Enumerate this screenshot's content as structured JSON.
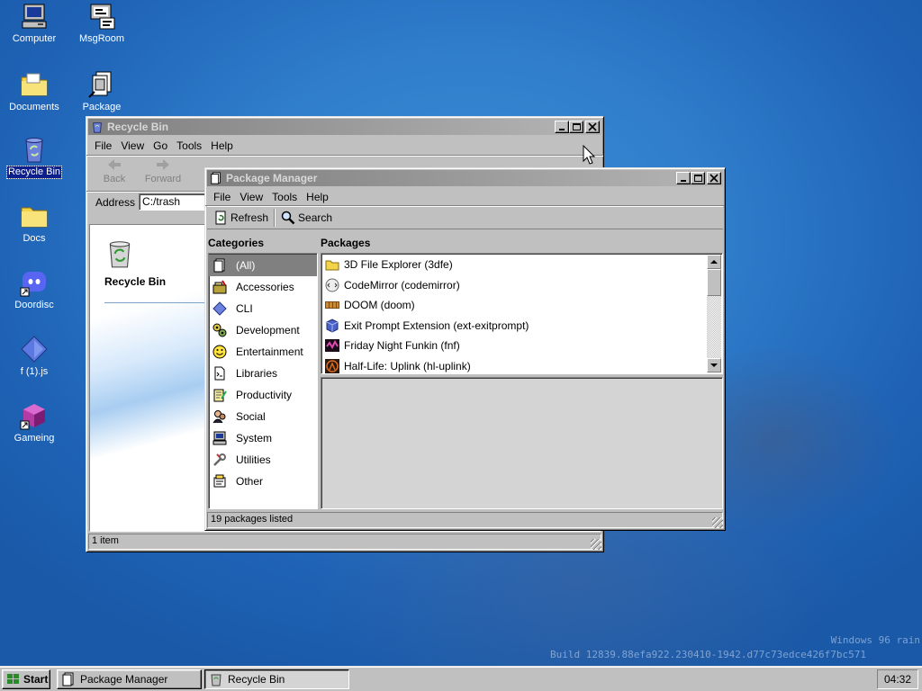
{
  "desktop": {
    "icons": [
      {
        "label": "Computer",
        "icon": "computer-icon"
      },
      {
        "label": "MsgRoom",
        "icon": "msgroom-icon"
      },
      {
        "label": "Documents",
        "icon": "folder-icon"
      },
      {
        "label": "Package",
        "icon": "package-icon"
      },
      {
        "label": "Recycle Bin",
        "icon": "recycle-bin-icon"
      },
      {
        "label": "Docs",
        "icon": "folder-icon"
      },
      {
        "label": "Doordisc",
        "icon": "discord-icon"
      },
      {
        "label": "f (1).js",
        "icon": "js-file-icon"
      },
      {
        "label": "Gameing",
        "icon": "cube-icon"
      }
    ],
    "watermark_line1": "Windows 96 rain",
    "watermark_line2": "Build 12839.88efa922.230410-1942.d77c73edce426f7bc571"
  },
  "recycle_bin": {
    "title": "Recycle Bin",
    "menu": [
      "File",
      "View",
      "Go",
      "Tools",
      "Help"
    ],
    "toolbar": {
      "back": "Back",
      "forward": "Forward"
    },
    "address_label": "Address",
    "address_value": "C:/trash",
    "heading": "Recycle Bin",
    "status": "1 item"
  },
  "package_manager": {
    "title": "Package Manager",
    "menu": [
      "File",
      "View",
      "Tools",
      "Help"
    ],
    "toolbar": {
      "refresh": "Refresh",
      "search": "Search"
    },
    "categories_header": "Categories",
    "packages_header": "Packages",
    "categories": [
      {
        "label": "(All)",
        "icon": "all-icon",
        "selected": true
      },
      {
        "label": "Accessories",
        "icon": "accessories-icon"
      },
      {
        "label": "CLI",
        "icon": "cli-icon"
      },
      {
        "label": "Development",
        "icon": "development-icon"
      },
      {
        "label": "Entertainment",
        "icon": "entertainment-icon"
      },
      {
        "label": "Libraries",
        "icon": "libraries-icon"
      },
      {
        "label": "Productivity",
        "icon": "productivity-icon"
      },
      {
        "label": "Social",
        "icon": "social-icon"
      },
      {
        "label": "System",
        "icon": "system-icon"
      },
      {
        "label": "Utilities",
        "icon": "utilities-icon"
      },
      {
        "label": "Other",
        "icon": "other-icon"
      }
    ],
    "packages": [
      {
        "label": "3D File Explorer (3dfe)",
        "icon": "folder-icon"
      },
      {
        "label": "CodeMirror (codemirror)",
        "icon": "codemirror-icon"
      },
      {
        "label": "DOOM (doom)",
        "icon": "doom-icon"
      },
      {
        "label": "Exit Prompt Extension (ext-exitprompt)",
        "icon": "extension-icon"
      },
      {
        "label": "Friday Night Funkin (fnf)",
        "icon": "fnf-icon"
      },
      {
        "label": "Half-Life: Uplink (hl-uplink)",
        "icon": "half-life-icon"
      }
    ],
    "status": "19 packages listed"
  },
  "taskbar": {
    "start_label": "Start",
    "tasks": [
      {
        "label": "Package Manager",
        "active": false
      },
      {
        "label": "Recycle Bin",
        "active": true
      }
    ],
    "clock": "04:32"
  }
}
